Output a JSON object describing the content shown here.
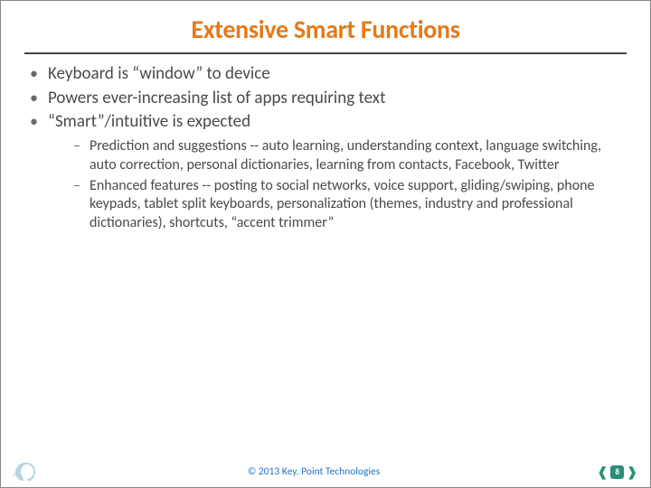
{
  "title": "Extensive Smart Functions",
  "bullets": {
    "b1": "Keyboard is “window” to device",
    "b2": "Powers ever-increasing list of apps requiring text",
    "b3": "“Smart”/intuitive is expected",
    "s1": "Prediction and suggestions -- auto learning, understanding context, language switching, auto correction, personal dictionaries, learning from contacts, Facebook, Twitter",
    "s2": "Enhanced features -- posting to social networks, voice support, gliding/swiping, phone keypads, tablet split keyboards, personalization (themes, industry and professional dictionaries), shortcuts, “accent trimmer”"
  },
  "footer": {
    "copyright": "© 2013 Key. Point Technologies",
    "page": "8"
  }
}
